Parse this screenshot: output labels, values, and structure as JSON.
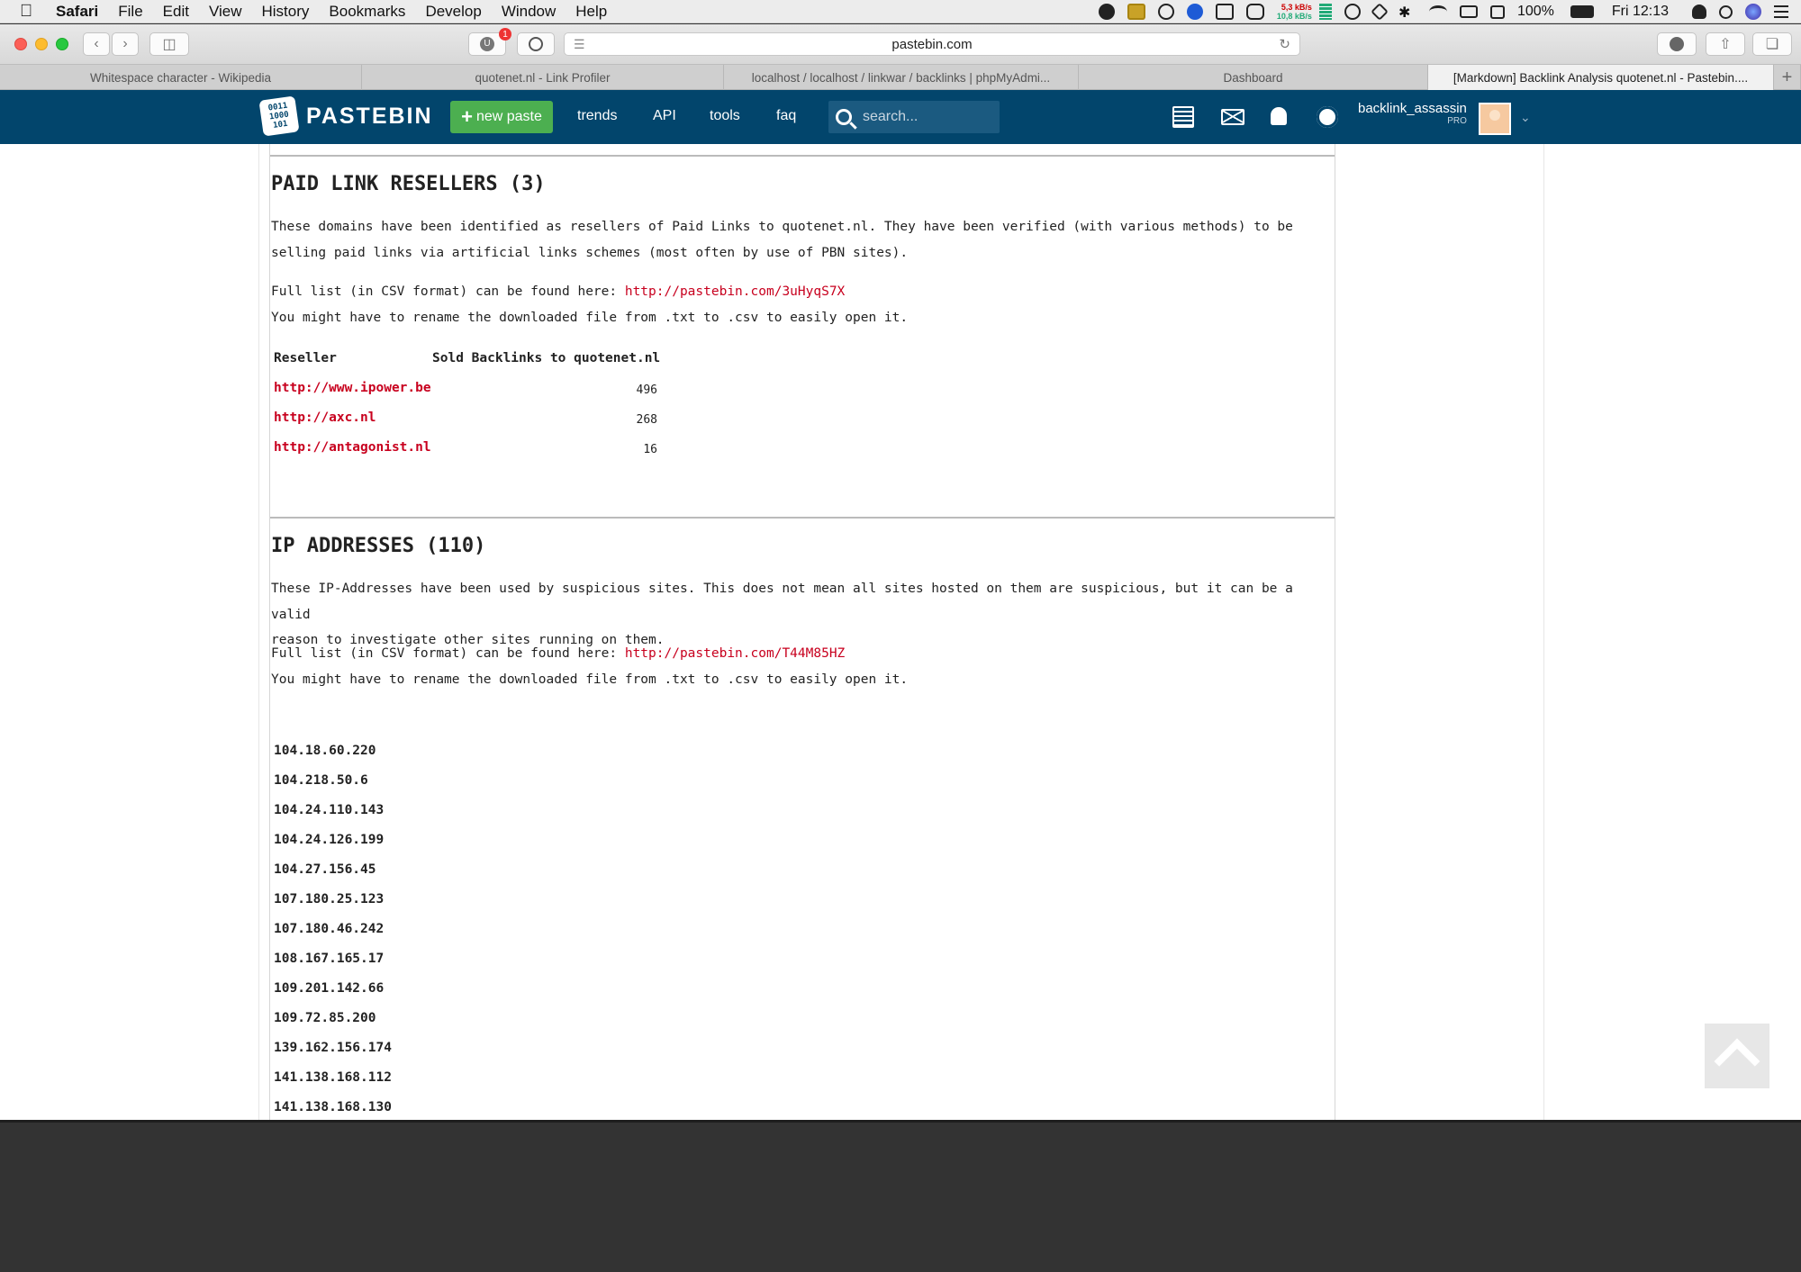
{
  "menubar": {
    "app": "Safari",
    "menus": [
      "File",
      "Edit",
      "View",
      "History",
      "Bookmarks",
      "Develop",
      "Window",
      "Help"
    ],
    "network_up": "5,3 kB/s",
    "network_down": "10,8 kB/s",
    "battery": "100%",
    "clock": "Fri 12:13"
  },
  "browser": {
    "address": "pastebin.com",
    "extension_badge": "1",
    "tabs": [
      "Whitespace character - Wikipedia",
      "quotenet.nl - Link Profiler",
      "localhost / localhost / linkwar / backlinks | phpMyAdmi...",
      "Dashboard",
      "[Markdown] Backlink Analysis quotenet.nl - Pastebin...."
    ],
    "new_tab": "+"
  },
  "header": {
    "logo_text": "PASTEBIN",
    "logo_digits": [
      "0011",
      "1000",
      "101"
    ],
    "new_paste": "new paste",
    "nav": [
      "trends",
      "API",
      "tools",
      "faq"
    ],
    "search_placeholder": "search...",
    "username": "backlink_assassin",
    "plan": "PRO"
  },
  "resellers": {
    "heading": "PAID LINK RESELLERS (3)",
    "intro_line1": "These domains have been identified as resellers of Paid Links to quotenet.nl. They have been verified (with various methods) to be",
    "intro_line2": "selling paid links via artificial links schemes (most often by use of PBN sites).",
    "csv_prefix": "Full list (in CSV format) can be found here: ",
    "csv_link": "http://pastebin.com/3uHyqS7X",
    "rename_note": "You might have to rename the downloaded file from .txt to .csv to easily open it.",
    "col_reseller": "Reseller",
    "col_sold": "Sold Backlinks to quotenet.nl",
    "rows": [
      {
        "domain": "http://www.ipower.be",
        "count": "496"
      },
      {
        "domain": "http://axc.nl",
        "count": "268"
      },
      {
        "domain": "http://antagonist.nl",
        "count": "16"
      }
    ]
  },
  "ips": {
    "heading": "IP ADDRESSES (110)",
    "intro_line1": "These IP-Addresses have been used by suspicious sites. This does not mean all sites hosted on them are suspicious, but it can be a valid",
    "intro_line2": "reason to investigate other sites running on them.",
    "csv_prefix": "Full list (in CSV format) can be found here: ",
    "csv_link": "http://pastebin.com/T44M85HZ",
    "rename_note": "You might have to rename the downloaded file from .txt to .csv to easily open it.",
    "list": [
      "104.18.60.220",
      "104.218.50.6",
      "104.24.110.143",
      "104.24.126.199",
      "104.27.156.45",
      "107.180.25.123",
      "107.180.46.242",
      "108.167.165.17",
      "109.201.142.66",
      "109.72.85.200",
      "139.162.156.174",
      "141.138.168.112",
      "141.138.168.130"
    ]
  }
}
